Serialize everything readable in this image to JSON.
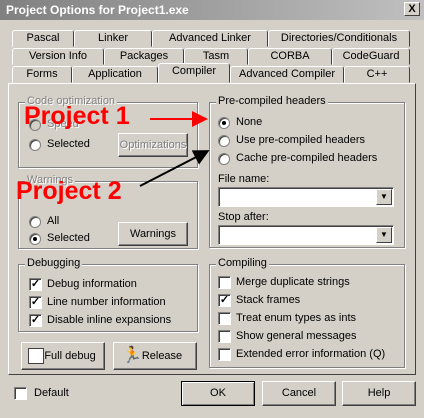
{
  "window": {
    "title": "Project Options for Project1.exe",
    "close_glyph": "X"
  },
  "tabs": {
    "row1": [
      "Pascal",
      "Linker",
      "Advanced Linker",
      "Directories/Conditionals"
    ],
    "row2": [
      "Version Info",
      "Packages",
      "Tasm",
      "CORBA",
      "CodeGuard"
    ],
    "row3": [
      "Forms",
      "Application",
      "Compiler",
      "Advanced Compiler",
      "C++"
    ]
  },
  "code_optimization": {
    "label": "Code optimization",
    "speed": "Speed",
    "selected": "Selected",
    "button": "Optimizations"
  },
  "warnings": {
    "label": "Warnings",
    "all": "All",
    "selected": "Selected",
    "button": "Warnings"
  },
  "debugging": {
    "label": "Debugging",
    "items": [
      "Debug information",
      "Line number information",
      "Disable inline expansions"
    ]
  },
  "full_debug_button": "Full debug",
  "release_button": "Release",
  "precompiled": {
    "label": "Pre-compiled headers",
    "options": [
      "None",
      "Use pre-compiled headers",
      "Cache pre-compiled headers"
    ],
    "file_name_label": "File name:",
    "stop_after_label": "Stop after:",
    "file_name_value": "",
    "stop_after_value": ""
  },
  "compiling": {
    "label": "Compiling",
    "items": [
      "Merge duplicate strings",
      "Stack frames",
      "Treat enum types as ints",
      "Show general messages",
      "Extended error information (Q)"
    ]
  },
  "footer": {
    "default": "Default",
    "ok": "OK",
    "cancel": "Cancel",
    "help": "Help"
  },
  "annotations": {
    "project1": "Project 1",
    "project2": "Project 2"
  },
  "colors": {
    "annotation": "#ff0000",
    "dialog_bg": "#d4d0c8"
  }
}
